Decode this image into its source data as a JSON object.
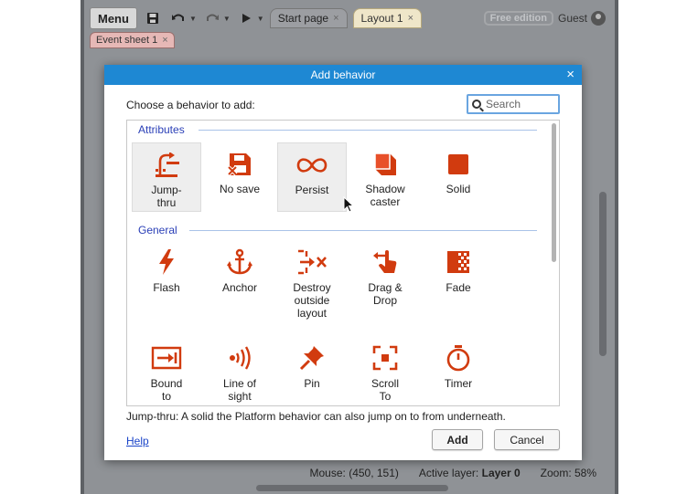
{
  "app": {
    "menu_label": "Menu",
    "tabs": [
      {
        "label": "Start page"
      },
      {
        "label": "Layout 1"
      }
    ],
    "free_badge": "Free edition",
    "user": "Guest",
    "sheet_tab": "Event sheet 1",
    "close_glyph": "×",
    "icons": [
      "save-icon",
      "undo-icon",
      "redo-icon",
      "play-icon",
      "user-icon"
    ]
  },
  "status_bar": {
    "mouse": "Mouse: (450, 151)",
    "active_layer_label": "Active layer:",
    "active_layer_value": "Layer 0",
    "zoom": "Zoom: 58%"
  },
  "dialog": {
    "title": "Add behavior",
    "prompt": "Choose a behavior to add:",
    "search_placeholder": "Search",
    "sections": [
      {
        "label": "Attributes"
      },
      {
        "label": "General"
      }
    ],
    "attributes": [
      {
        "label": "Jump-\nthru",
        "icon": "jump-thru-icon",
        "selected": true
      },
      {
        "label": "No save",
        "icon": "no-save-icon",
        "selected": false
      },
      {
        "label": "Persist",
        "icon": "persist-icon",
        "selected": false
      },
      {
        "label": "Shadow\ncaster",
        "icon": "shadow-caster-icon",
        "selected": false
      },
      {
        "label": "Solid",
        "icon": "solid-icon",
        "selected": false
      }
    ],
    "general_row1": [
      {
        "label": "Flash",
        "icon": "flash-icon"
      },
      {
        "label": "Anchor",
        "icon": "anchor-icon"
      },
      {
        "label": "Destroy\noutside\nlayout",
        "icon": "destroy-outside-icon"
      },
      {
        "label": "Drag &\nDrop",
        "icon": "drag-drop-icon"
      },
      {
        "label": "Fade",
        "icon": "fade-icon"
      }
    ],
    "general_row2": [
      {
        "label": "Bound\nto",
        "icon": "bound-to-icon"
      },
      {
        "label": "Line of\nsight",
        "icon": "line-of-sight-icon"
      },
      {
        "label": "Pin",
        "icon": "pin-icon"
      },
      {
        "label": "Scroll\nTo",
        "icon": "scroll-to-icon"
      },
      {
        "label": "Timer",
        "icon": "timer-icon"
      }
    ],
    "description": "Jump-thru: A solid the Platform behavior can also jump on to from underneath.",
    "help_label": "Help",
    "add_label": "Add",
    "cancel_label": "Cancel",
    "accent_color": "#d13b0f",
    "titlebar_color": "#1e88d3"
  }
}
